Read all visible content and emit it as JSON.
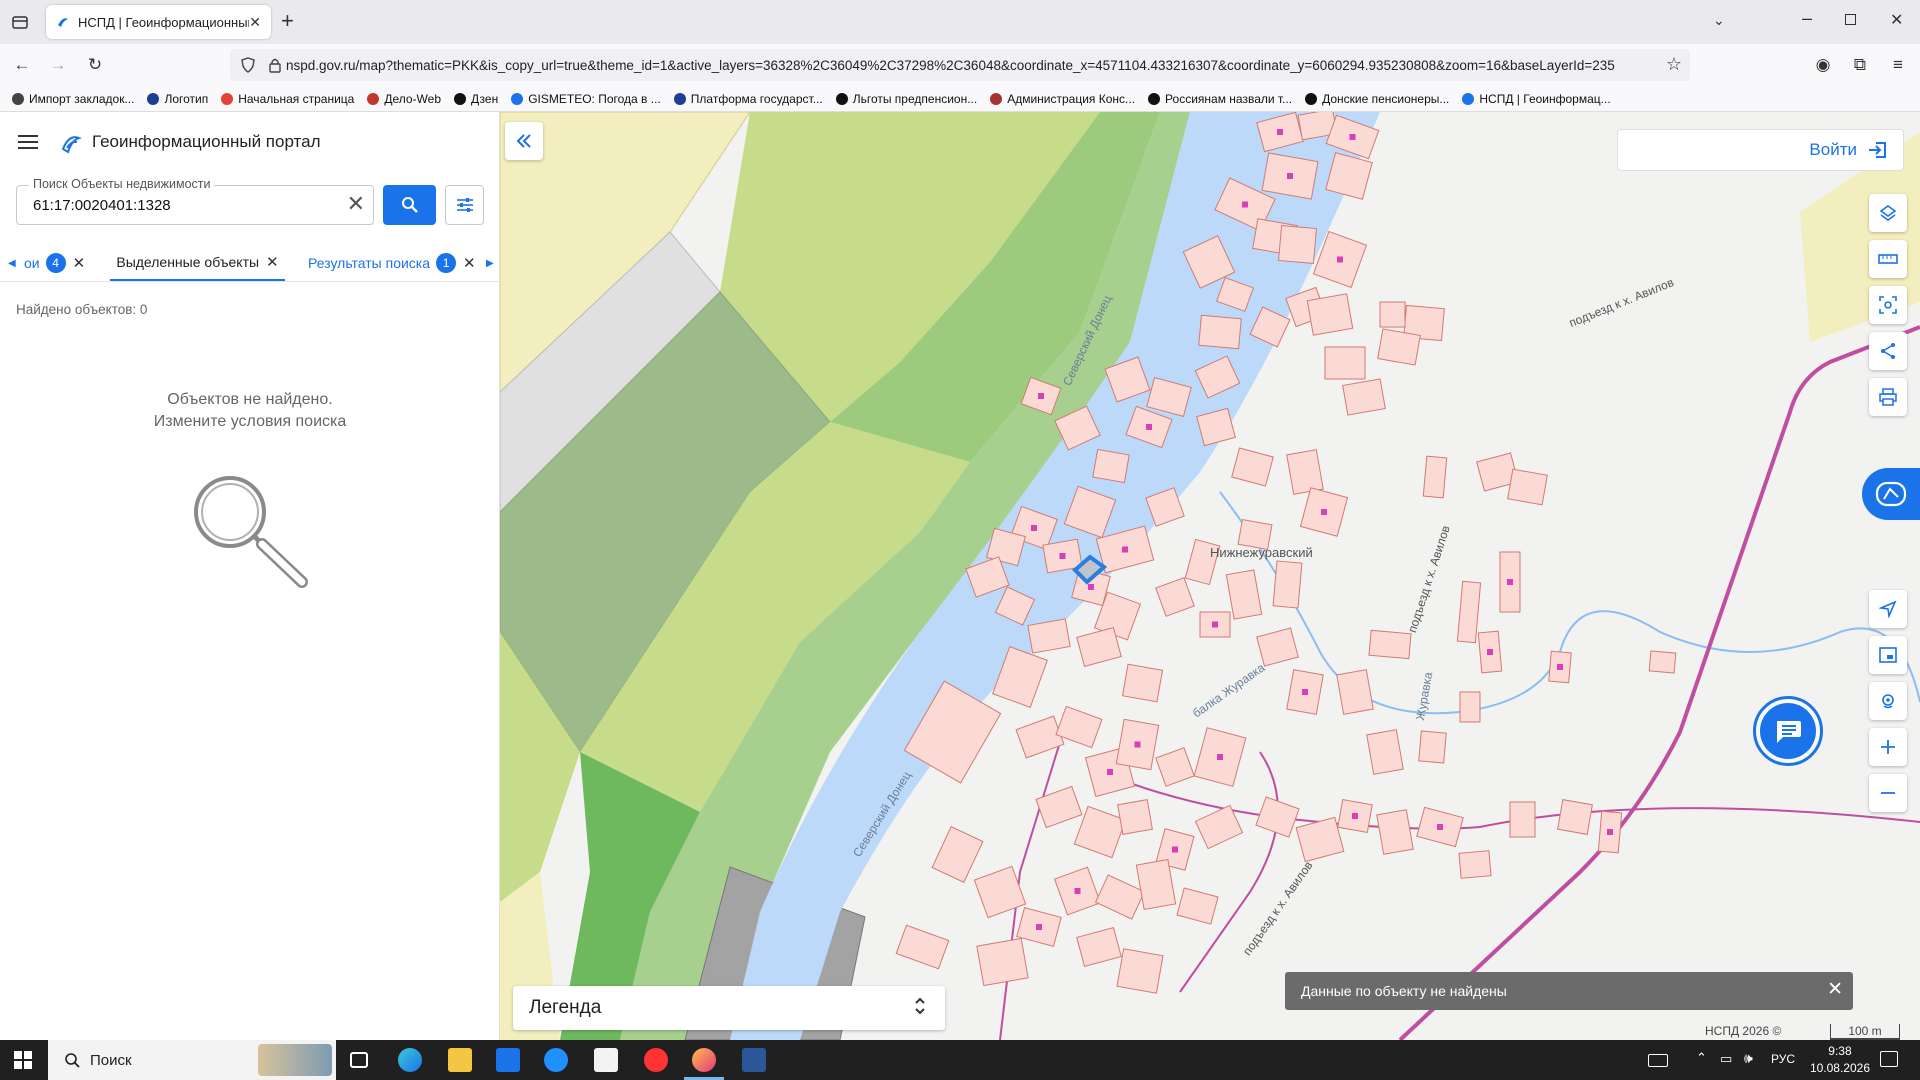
{
  "browser": {
    "tab_title": "НСПД | Геоинформационный",
    "url": "nspd.gov.ru/map?thematic=PKK&is_copy_url=true&theme_id=1&active_layers=36328%2C36049%2C37298%2C36048&coordinate_x=4571104.433216307&coordinate_y=6060294.935230808&zoom=16&baseLayerId=235",
    "bookmarks": [
      {
        "label": "Импорт закладок...",
        "color": "#444"
      },
      {
        "label": "Логотип",
        "color": "#1c3f94"
      },
      {
        "label": "Начальная страница",
        "color": "#e34234"
      },
      {
        "label": "Дело-Web",
        "color": "#c0392b"
      },
      {
        "label": "Дзен",
        "color": "#111"
      },
      {
        "label": "GISMETEO: Погода в ...",
        "color": "#1a73e8"
      },
      {
        "label": "Платформа государст...",
        "color": "#1c3f94"
      },
      {
        "label": "Льготы предпенсион...",
        "color": "#111"
      },
      {
        "label": "Администрация Конс...",
        "color": "#a83232"
      },
      {
        "label": "Россиянам назвали т...",
        "color": "#111"
      },
      {
        "label": "Донские пенсионеры...",
        "color": "#111"
      },
      {
        "label": "НСПД | Геоинформац...",
        "color": "#1a73e8"
      }
    ]
  },
  "panel": {
    "portal_title": "Геоинформационный портал",
    "search_label": "Поиск Объекты недвижимости",
    "search_value": "61:17:0020401:1328",
    "tabs": [
      {
        "label": "ои",
        "badge": "4"
      },
      {
        "label": "Выделенные объекты"
      },
      {
        "label": "Результаты поиска",
        "badge": "1"
      }
    ],
    "found_text": "Найдено объектов: 0",
    "empty_line1": "Объектов не найдено.",
    "empty_line2": "Измените условия поиска"
  },
  "map": {
    "login_label": "Войти",
    "legend_label": "Легенда",
    "toast_text": "Данные по объекту не найдены",
    "copyright": "НСПД 2026 ©",
    "scale_label": "100 m",
    "labels": {
      "river_1": "Северский Донец",
      "river_2": "Северский Донец",
      "village": "Нижнежуравский",
      "creek": "балка Журавка",
      "road_1": "подъезд к х. Авилов",
      "road_2": "подъезд к х. Авилов",
      "road_3": "подъезд к х. Авилов",
      "creek_2": "Журавка"
    },
    "colors": {
      "water": "#bcd9fa",
      "parcel_fill": "#fbd9d5",
      "parcel_stroke": "#d07b73",
      "forest": "#9dbb8a",
      "field": "#c6dc8a",
      "selected": "#2a7de1",
      "accent": "#1a73e8"
    }
  },
  "taskbar": {
    "search_placeholder": "Поиск",
    "lang": "РУС",
    "time": "9:38",
    "date": "10.08.2026"
  }
}
